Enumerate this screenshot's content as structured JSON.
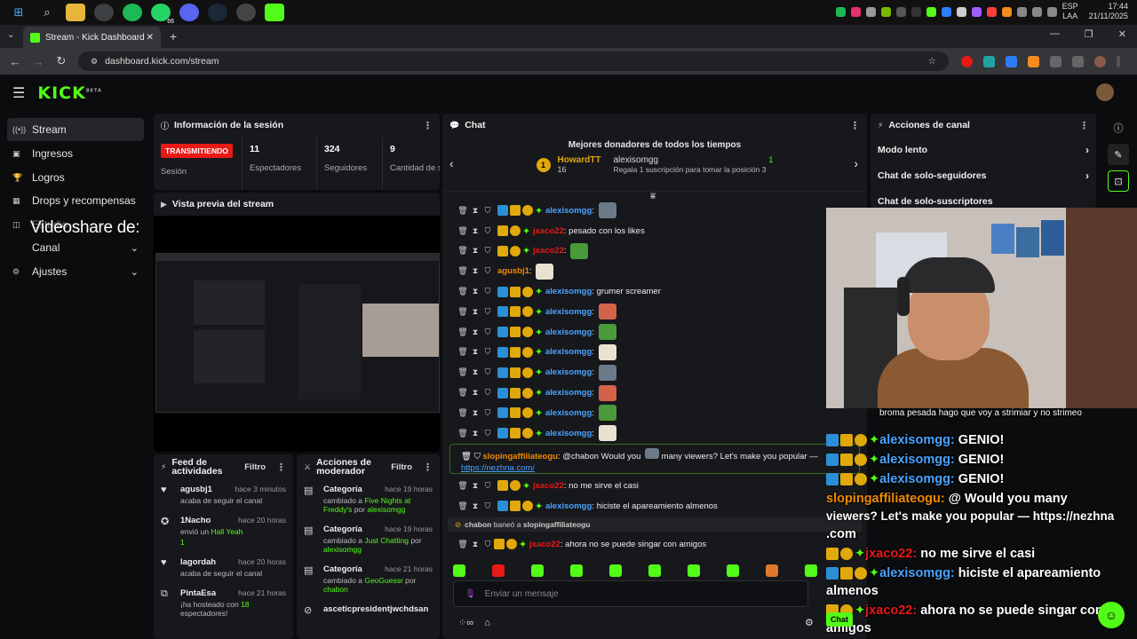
{
  "taskbar": {
    "icons": [
      "windows-start-icon",
      "search-icon",
      "file-explorer-icon",
      "chrome-icon",
      "spotify-icon",
      "whatsapp-icon",
      "discord-icon",
      "steam-icon",
      "game-launcher-icon",
      "kick-icon"
    ],
    "badge_whatsapp": "66",
    "lang_top": "ESP",
    "lang_bottom": "LAA",
    "time": "17:44",
    "date": "21/11/2025"
  },
  "browser": {
    "tab_title": "Stream - Kick Dashboard",
    "url": "dashboard.kick.com/stream"
  },
  "kick": {
    "logo": "KICK",
    "logo_sup": "BETA"
  },
  "sidebar": {
    "items": [
      {
        "label": "Stream",
        "icon": "broadcast-icon"
      },
      {
        "label": "Ingresos",
        "icon": "wallet-icon"
      },
      {
        "label": "Logros",
        "icon": "trophy-icon"
      },
      {
        "label": "Drops y recompensas",
        "icon": "gift-icon"
      },
      {
        "label": "Estudio",
        "icon": "studio-icon"
      },
      {
        "label": "Canal",
        "icon": "channel-icon"
      },
      {
        "label": "Ajustes",
        "icon": "gear-icon"
      }
    ],
    "overlay_text": "Videoshare de:"
  },
  "session": {
    "title": "Información de la sesión",
    "live_badge": "TRANSMITIENDO",
    "live_label": "Sesión",
    "stats": [
      {
        "value": "11",
        "label": "Espectadores"
      },
      {
        "value": "324",
        "label": "Seguidores"
      },
      {
        "value": "9",
        "label": "Cantidad de suscripciones"
      }
    ]
  },
  "preview": {
    "title": "Vista previa del stream"
  },
  "feed": {
    "title": "Feed de actividades",
    "filter": "Filtro",
    "items": [
      {
        "name": "agusbj1",
        "time": "hace 3 minutos",
        "text": "acaba de seguir el canal",
        "icon": "heart-icon"
      },
      {
        "name": "1Nacho",
        "time": "hace 20 horas",
        "text": "envió un",
        "highlight": "Hall Yeah",
        "extra": "1",
        "icon": "kick-coin-icon"
      },
      {
        "name": "lagordah",
        "time": "hace 20 horas",
        "text": "acaba de seguir el canal",
        "icon": "heart-icon"
      },
      {
        "name": "PintaEsa",
        "time": "hace 21 horas",
        "text": "¡ha hosteado con",
        "highlight": "18",
        "text2": "espectadores!",
        "icon": "host-icon"
      }
    ]
  },
  "mod": {
    "title": "Acciones de moderador",
    "filter": "Filtro",
    "items": [
      {
        "name": "Categoría",
        "time": "hace 19 horas",
        "text": "cambiado a",
        "highlight": "Five Nights at Freddy's",
        "by": "por",
        "user": "alexisomgg"
      },
      {
        "name": "Categoría",
        "time": "hace 19 horas",
        "text": "cambiado a",
        "highlight": "Just Chatting",
        "by": "por",
        "user": "alexisomgg"
      },
      {
        "name": "Categoría",
        "time": "hace 21 horas",
        "text": "cambiado a",
        "highlight": "GeoGuessr",
        "by": "por",
        "user": "chabon"
      },
      {
        "name": "asceticpresidentjwchdsan",
        "time": "",
        "text": "",
        "highlight": "",
        "by": "",
        "user": ""
      }
    ]
  },
  "chat": {
    "title": "Chat",
    "donors_title": "Mejores donadores de todos los tiempos",
    "donor1_name": "HowardTT",
    "donor1_count": "16",
    "donor2_name": "alexisomgg",
    "donor2_count": "1",
    "donor2_text": "Regala 1 suscripción para tomar la posición 3",
    "messages": [
      {
        "user": "alexisomgg",
        "color": "blue",
        "text": "",
        "emote": true
      },
      {
        "user": "jxaco22",
        "color": "red",
        "text": "pesado con los likes",
        "emote": false
      },
      {
        "user": "jxaco22",
        "color": "red",
        "text": "",
        "emote": true
      },
      {
        "user": "agusbj1",
        "color": "orange",
        "text": "",
        "emote": true
      },
      {
        "user": "alexisomgg",
        "color": "blue",
        "text": "grumer screamer",
        "emote": false
      },
      {
        "user": "alexisomgg",
        "color": "blue",
        "text": "",
        "emote": true
      },
      {
        "user": "alexisomgg",
        "color": "blue",
        "text": "",
        "emote": true
      },
      {
        "user": "alexisomgg",
        "color": "blue",
        "text": "",
        "emote": true
      },
      {
        "user": "alexisomgg",
        "color": "blue",
        "text": "",
        "emote": true
      },
      {
        "user": "alexisomgg",
        "color": "blue",
        "text": "",
        "emote": true
      },
      {
        "user": "alexisomgg",
        "color": "blue",
        "text": "",
        "emote": true
      },
      {
        "user": "alexisomgg",
        "color": "blue",
        "text": "",
        "emote": true
      }
    ],
    "spam_user": "slopingaffiliateogu",
    "spam_text": "@chabon Would you",
    "spam_text2": "many viewers? Let's make you popular —",
    "spam_link": "https://nezhna.com/",
    "messages2": [
      {
        "user": "jxaco22",
        "color": "red",
        "text": "no me sirve el casi"
      },
      {
        "user": "alexisomgg",
        "color": "blue",
        "text": "hiciste el apareamiento almenos"
      }
    ],
    "ban_user": "chabon",
    "ban_text": "baneó a",
    "ban_target": "slopingaffiliateogu",
    "last": {
      "user": "jxaco22",
      "color": "red",
      "text": "ahora no se puede singar con amigos"
    },
    "input_placeholder": "Enviar un mensaje"
  },
  "actions": {
    "title": "Acciones de canal",
    "items": [
      "Modo lento",
      "Chat de solo-seguidores",
      "Chat de solo-suscriptores"
    ]
  },
  "overlay_chat": {
    "lines": [
      {
        "user": "",
        "text": "broma pesada hago que voy a strimiar y no strimeo"
      },
      {
        "user": "alexisomgg:",
        "text": "GENIO!"
      },
      {
        "user": "alexisomgg:",
        "text": "GENIO!"
      },
      {
        "user": "alexisomgg:",
        "text": "GENIO!"
      },
      {
        "user": "slopingaffiliateogu:",
        "text": "@ Would you many"
      },
      {
        "user": "",
        "text": "viewers? Let's make you popular — https://nezhna"
      },
      {
        "user": "",
        "text": ".com"
      },
      {
        "user": "jxaco22:",
        "text": "no me sirve el casi"
      },
      {
        "user": "alexisomgg:",
        "text": "hiciste el apareamiento"
      },
      {
        "user": "",
        "text": "almenos"
      },
      {
        "user": "jxaco22:",
        "text": "ahora no se puede singar con"
      },
      {
        "user": "",
        "text": "amigos"
      }
    ],
    "chat_btn": "Chat"
  },
  "colors": {
    "accent": "#53fc18",
    "live": "#e91916",
    "blue_user": "#4ba3ff",
    "red_user": "#e91916"
  }
}
